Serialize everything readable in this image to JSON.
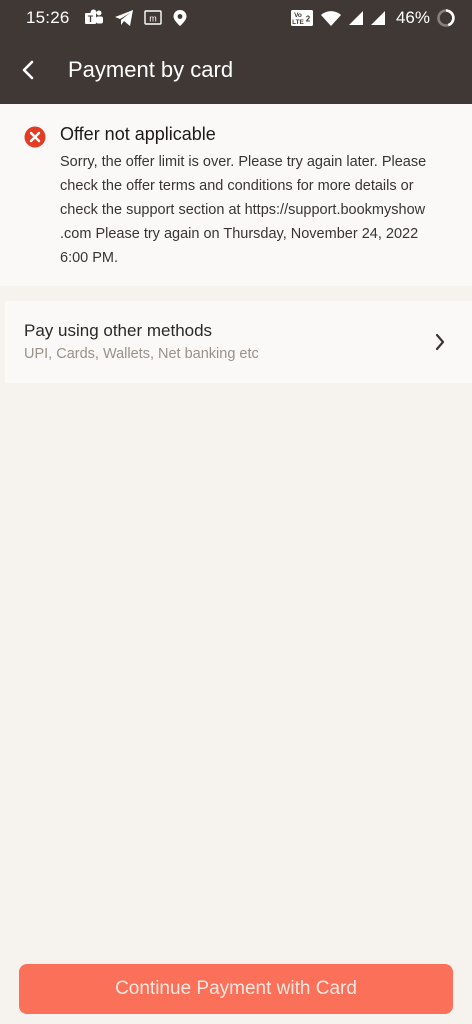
{
  "status_bar": {
    "time": "15:26",
    "battery": "46%",
    "icons": [
      "teams-icon",
      "telegram-icon",
      "m-app-icon",
      "location-icon",
      "volte-icon",
      "wifi-icon",
      "signal-icon",
      "signal-icon",
      "battery-icon"
    ],
    "volte_label": "Vo LTE 2"
  },
  "app_bar": {
    "title": "Payment by card",
    "back_icon": "chevron-left-icon"
  },
  "offer": {
    "icon": "error-icon",
    "title": "Offer not applicable",
    "body": "Sorry, the offer limit is over. Please try again later. Please check the offer terms and conditions for more details or check the support section at https://support.bookmyshow .com Please try again on Thursday, November 24, 2022 6:00 PM.",
    "icon_color": "#e23d24"
  },
  "other_methods": {
    "title": "Pay using other methods",
    "subtitle": "UPI, Cards, Wallets, Net banking etc",
    "chevron_icon": "chevron-right-icon"
  },
  "footer": {
    "continue_label": "Continue Payment with Card",
    "button_color": "#fb7058"
  },
  "colors": {
    "header": "#403835",
    "background": "#f6f3ef"
  }
}
